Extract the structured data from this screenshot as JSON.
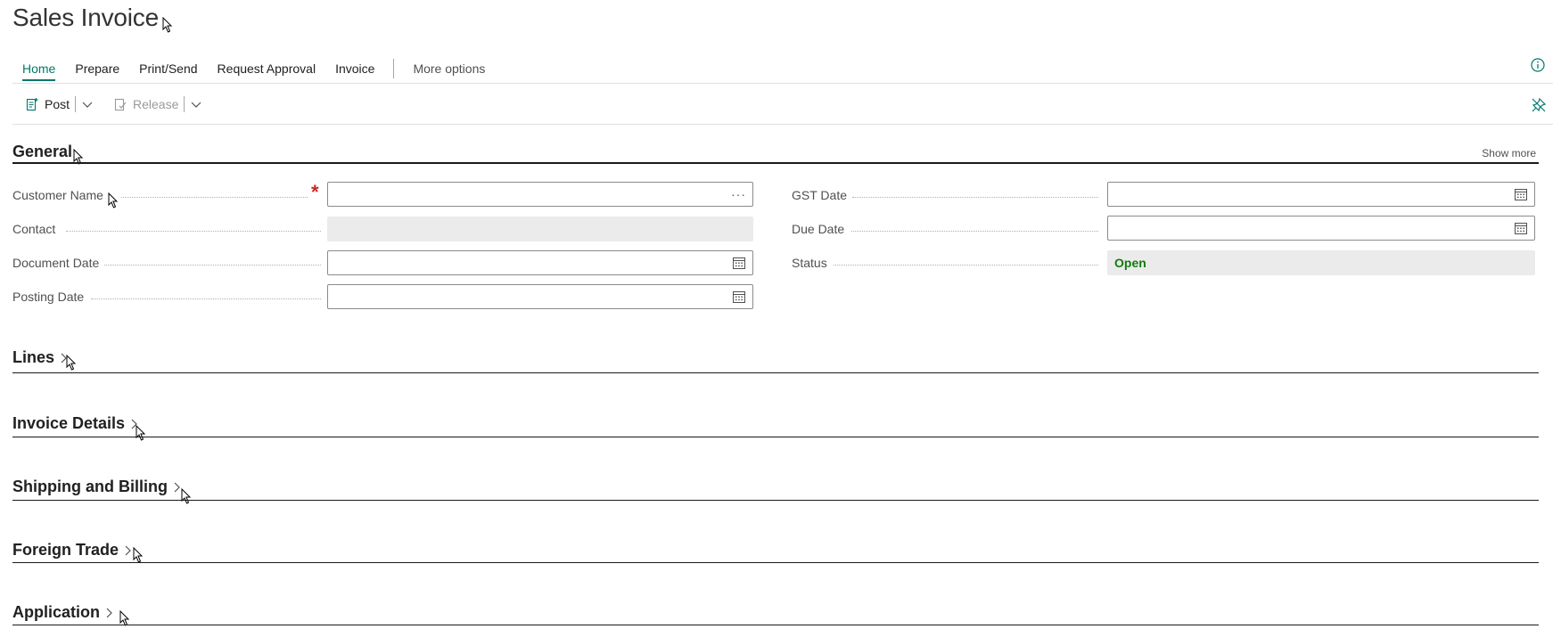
{
  "page": {
    "title": "Sales Invoice"
  },
  "tabs": [
    {
      "label": "Home",
      "active": true
    },
    {
      "label": "Prepare"
    },
    {
      "label": "Print/Send"
    },
    {
      "label": "Request Approval"
    },
    {
      "label": "Invoice"
    },
    {
      "label": "More options"
    }
  ],
  "actions": {
    "post_label": "Post",
    "release_label": "Release"
  },
  "sections": {
    "general": "General",
    "show_more": "Show more",
    "lines": "Lines",
    "invoice_details": "Invoice Details",
    "shipping_billing": "Shipping and Billing",
    "foreign_trade": "Foreign Trade",
    "application": "Application"
  },
  "fields": {
    "customer_name": {
      "label": "Customer Name",
      "value": "",
      "required": true
    },
    "contact": {
      "label": "Contact",
      "value": ""
    },
    "document_date": {
      "label": "Document Date",
      "value": ""
    },
    "posting_date": {
      "label": "Posting Date",
      "value": ""
    },
    "gst_date": {
      "label": "GST Date",
      "value": ""
    },
    "due_date": {
      "label": "Due Date",
      "value": ""
    },
    "status": {
      "label": "Status",
      "value": "Open"
    }
  },
  "colors": {
    "accent": "#00796b",
    "status_open": "#107c10",
    "required": "#c62828"
  }
}
